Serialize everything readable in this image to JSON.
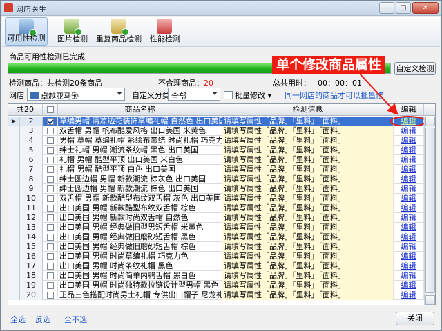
{
  "window": {
    "title": "网店医生",
    "min": "–",
    "max": "□",
    "close": "✕"
  },
  "toolbar": {
    "items": [
      {
        "label": "可用性检测",
        "icon": "document-check-icon",
        "active": true
      },
      {
        "label": "图片检测",
        "icon": "image-check-icon"
      },
      {
        "label": "重复商品检测",
        "icon": "duplicate-check-icon"
      },
      {
        "label": "性能检测",
        "icon": "performance-icon"
      }
    ]
  },
  "status": {
    "label": "商品可用性检测已完成",
    "progress": 1.0
  },
  "custom_button": "自定义检测",
  "callout": "单个修改商品属性",
  "info": {
    "checked_label": "检测商品：",
    "checked_value": "共检测20条商品",
    "unreasonable_label": "不合理商品：",
    "unreasonable_value": "20",
    "time_label": "总共用时：",
    "time_value": "00：00：01"
  },
  "filter": {
    "shop_label": "网店",
    "shop_value": "卓越亚马逊",
    "category_label": "自定义分类",
    "category_value": "全部",
    "batch_label": "批量修改",
    "hint": "同一网店的商品才可以批量修"
  },
  "grid": {
    "count_header": "共20",
    "name_header": "商品名称",
    "info_header": "检测信息",
    "edit_header": "编辑",
    "rows": [
      {
        "n": "2",
        "name": "草编男帽 清凉边花装饰草编礼帽 自然色 出口美国",
        "info": "请填写属性「品牌」「里料」「面料」",
        "edit": "编辑",
        "checked": true,
        "selected": true
      },
      {
        "n": "3",
        "name": "双舌帽 男帽 帆布酷爱风格 出口美国 米黄色",
        "info": "请填写属性「品牌」「里料」「面料」",
        "edit": "编辑"
      },
      {
        "n": "4",
        "name": "男帽 草帽 草编礼帽 彩绘布带结 时尚礼帽 巧克力...",
        "info": "请填写属性「品牌」「里料」「面料」",
        "edit": "编辑"
      },
      {
        "n": "5",
        "name": "绅士礼帽 男帽 潮流条纹帽 黑色 出口美国",
        "info": "请填写属性「品牌」「里料」「面料」",
        "edit": "编辑"
      },
      {
        "n": "6",
        "name": "礼帽 男帽 酷型平顶 出口美国 米白色",
        "info": "请填写属性「品牌」「里料」「面料」",
        "edit": "编辑"
      },
      {
        "n": "7",
        "name": "礼帽 男帽 酷型平顶 白色 出口美国",
        "info": "请填写属性「品牌」「里料」「面料」",
        "edit": "编辑"
      },
      {
        "n": "8",
        "name": "绅士圆边帽 男帽 新款潮流 棕灰色 出口美国",
        "info": "请填写属性「品牌」「里料」「面料」",
        "edit": "编辑"
      },
      {
        "n": "9",
        "name": "绅士圆边帽 男帽 新款潮流 棕色 出口美国",
        "info": "请填写属性「品牌」「里料」「面料」",
        "edit": "编辑"
      },
      {
        "n": "10",
        "name": "双舌帽 男帽 新款酷型布纹双舌帽 灰色 出口美国",
        "info": "请填写属性「品牌」「里料」「面料」",
        "edit": "编辑"
      },
      {
        "n": "11",
        "name": "出口美国 男帽 新款酷型布纹双舌帽 棕色",
        "info": "请填写属性「品牌」「里料」「面料」",
        "edit": "编辑"
      },
      {
        "n": "12",
        "name": "出口美国 男帽 新款时尚双舌帽 自然色",
        "info": "请填写属性「品牌」「里料」「面料」",
        "edit": "编辑"
      },
      {
        "n": "13",
        "name": "出口美国 男帽 经典做旧型男短舌帽 米黄色",
        "info": "请填写属性「品牌」「里料」「面料」",
        "edit": "编辑"
      },
      {
        "n": "14",
        "name": "出口美国 男帽 经典做旧磨砂短舌帽 黑色",
        "info": "请填写属性「品牌」「里料」「面料」",
        "edit": "编辑"
      },
      {
        "n": "15",
        "name": "出口美国 男帽 经典做旧磨砂短舌帽 棕色",
        "info": "请填写属性「品牌」「里料」「面料」",
        "edit": "编辑"
      },
      {
        "n": "16",
        "name": "出口美国 男帽 时尚草编礼帽 巧克力色",
        "info": "请填写属性「品牌」「里料」「面料」",
        "edit": "编辑"
      },
      {
        "n": "17",
        "name": "出口美国 男帽 时尚条纹礼帽 黑色",
        "info": "请填写属性「品牌」「里料」「面料」",
        "edit": "编辑"
      },
      {
        "n": "18",
        "name": "出口美国 男帽 时尚简单内鸭舌帽 黑白色",
        "info": "请填写属性「品牌」「里料」「面料」",
        "edit": "编辑"
      },
      {
        "n": "19",
        "name": "出口美国 男帽 时尚独特款拉链设计型男帽 黑色",
        "info": "请填写属性「品牌」「里料」「面料」",
        "edit": "编辑"
      },
      {
        "n": "20",
        "name": "正品三色搭配时尚男士礼帽 专供出口帽子 尼龙礼帽...",
        "info": "请填写属性「品牌」「里料」「面料」",
        "edit": "编辑"
      }
    ]
  },
  "footer": {
    "select_all": "全选",
    "invert": "反选",
    "select_none": "全不选",
    "close": "关闭"
  },
  "colors": {
    "accent_red": "#ef1d11",
    "progress_green": "#22b21e",
    "selected_row": "#3b73d3",
    "info_bg": "#fff9d6"
  }
}
